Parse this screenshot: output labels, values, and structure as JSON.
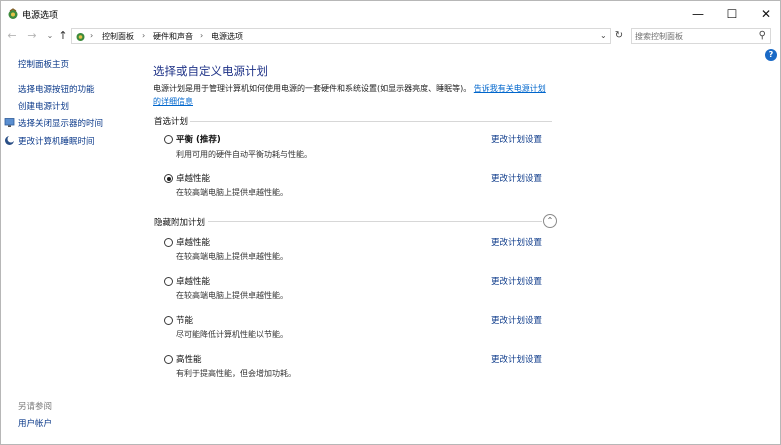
{
  "window": {
    "title": "电源选项",
    "min_glyph": "—",
    "max_glyph": "☐",
    "close_glyph": "✕"
  },
  "navigation": {
    "back_glyph": "←",
    "forward_glyph": "→",
    "recent_glyph": "⌄",
    "up_glyph": "↑",
    "breadcrumb": [
      "控制面板",
      "硬件和声音",
      "电源选项"
    ],
    "separator_glyph": "›",
    "dropdown_glyph": "⌄",
    "refresh_glyph": "↻",
    "search_placeholder": "搜索控制面板",
    "search_value": "",
    "search_glyph": "⚲"
  },
  "help": {
    "glyph": "?"
  },
  "sidebar": {
    "home": "控制面板主页",
    "links": [
      "选择电源按钮的功能",
      "创建电源计划",
      "选择关闭显示器的时间",
      "更改计算机睡眠时间"
    ],
    "see_also_title": "另请参阅",
    "see_also_links": [
      "用户帐户"
    ]
  },
  "main": {
    "title": "选择或自定义电源计划",
    "description": "电源计划是用于管理计算机如何使用电源的一套硬件和系统设置(如显示器亮度、睡眠等)。",
    "description_link": "告诉我有关电源计划的详细信息",
    "preferred_section": "首选计划",
    "hidden_section": "隐藏附加计划",
    "collapse_glyph": "⌃",
    "preferred_plans": [
      {
        "name": "平衡 (推荐)",
        "desc": "利用可用的硬件自动平衡功耗与性能。",
        "link": "更改计划设置",
        "selected": false
      },
      {
        "name": "卓越性能",
        "desc": "在较高端电脑上提供卓越性能。",
        "link": "更改计划设置",
        "selected": true
      }
    ],
    "hidden_plans": [
      {
        "name": "卓越性能",
        "desc": "在较高端电脑上提供卓越性能。",
        "link": "更改计划设置",
        "selected": false
      },
      {
        "name": "卓越性能",
        "desc": "在较高端电脑上提供卓越性能。",
        "link": "更改计划设置",
        "selected": false
      },
      {
        "name": "节能",
        "desc": "尽可能降低计算机性能以节能。",
        "link": "更改计划设置",
        "selected": false
      },
      {
        "name": "高性能",
        "desc": "有利于提高性能，但会增加功耗。",
        "link": "更改计划设置",
        "selected": false
      }
    ]
  }
}
